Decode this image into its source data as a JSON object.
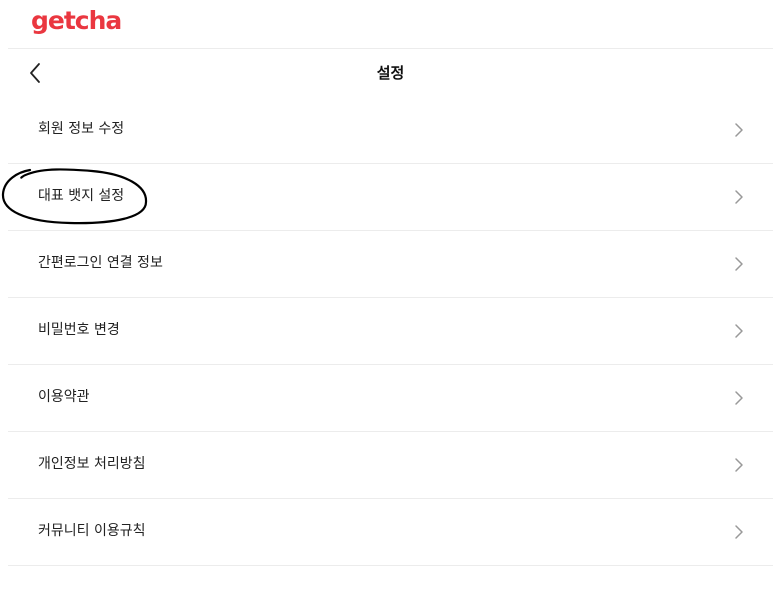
{
  "brand": {
    "logo_text": "getcha",
    "accent": "#ea3740"
  },
  "header": {
    "title": "설정",
    "back_icon": "chevron-left-icon"
  },
  "menu": {
    "items": [
      {
        "label": "회원 정보 수정"
      },
      {
        "label": "대표 뱃지 설정"
      },
      {
        "label": "간편로그인 연결 정보"
      },
      {
        "label": "비밀번호 변경"
      },
      {
        "label": "이용약관"
      },
      {
        "label": "개인정보 처리방침"
      },
      {
        "label": "커뮤니티 이용규칙"
      }
    ],
    "row_icon": "chevron-right-icon"
  }
}
